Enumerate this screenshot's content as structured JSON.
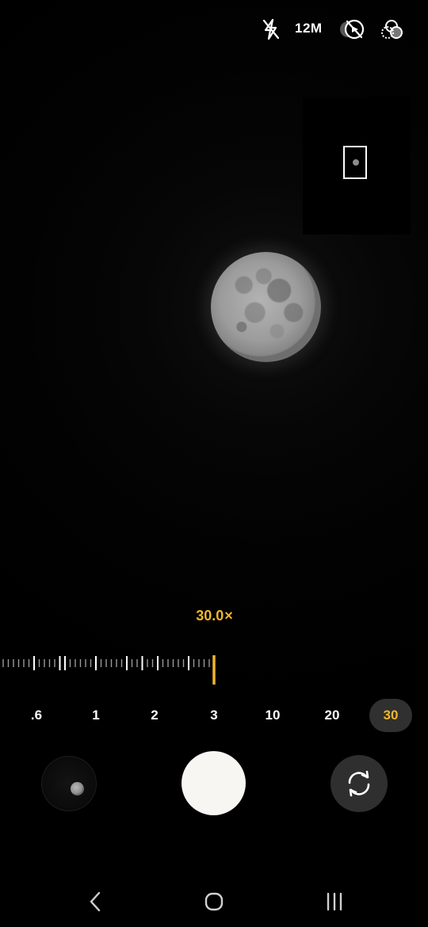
{
  "topbar": {
    "flash_icon": "flash-off-icon",
    "resolution": "12M",
    "motion_icon": "motion-photo-off-icon",
    "filter_icon": "filters-icon"
  },
  "viewfinder": {
    "subject": "moon",
    "zoom_map_visible": true
  },
  "zoom": {
    "readout": "30.0",
    "readout_suffix": "×",
    "level": 30,
    "min": 0.6,
    "max": 30,
    "presets": [
      {
        "label": ".6",
        "active": false
      },
      {
        "label": "1",
        "active": false
      },
      {
        "label": "2",
        "active": false
      },
      {
        "label": "3",
        "active": false
      },
      {
        "label": "10",
        "active": false
      },
      {
        "label": "20",
        "active": false
      },
      {
        "label": "30",
        "active": true
      }
    ]
  },
  "controls": {
    "gallery_icon": "gallery-thumbnail",
    "shutter_icon": "shutter-button",
    "switch_icon": "switch-camera-icon"
  },
  "nav": {
    "back_icon": "back-icon",
    "home_icon": "home-icon",
    "recents_icon": "recents-icon"
  },
  "colors": {
    "accent": "#f0b62b",
    "background": "#000000",
    "control_bg": "#2f2f2f",
    "shutter": "#f7f6f2"
  }
}
